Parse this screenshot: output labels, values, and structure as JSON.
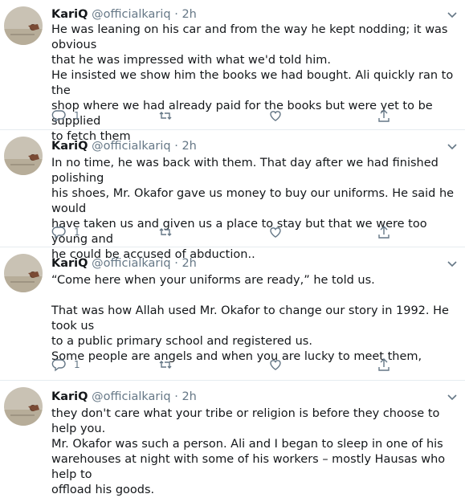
{
  "tweets": [
    {
      "name": "KariQ",
      "handle": "@officialkariq",
      "sep": "·",
      "time": "2h",
      "lines": [
        "He was leaning on his car and from the way he kept nodding; it was obvious",
        "that he was impressed with what we'd told him.",
        "He insisted we show him the books we had bought. Ali quickly ran to the",
        "shop where we had already paid for the books but were yet to be supplied",
        "to fetch them"
      ],
      "reply_count": "1"
    },
    {
      "name": "KariQ",
      "handle": "@officialkariq",
      "sep": "·",
      "time": "2h",
      "lines": [
        "In no time, he was back with them. That day after we had finished polishing",
        "his shoes, Mr. Okafor gave us money to buy our uniforms. He said he would",
        "have taken us and given us a place to stay but that we were too young and",
        "he could be accused of abduction.."
      ],
      "reply_count": "1"
    },
    {
      "name": "KariQ",
      "handle": "@officialkariq",
      "sep": "·",
      "time": "2h",
      "lines": [
        "“Come here when your uniforms are ready,” he told us.",
        "",
        "That was how Allah used Mr. Okafor to change our story in 1992. He took us",
        "to a public primary school and registered us.",
        "Some people are angels and when you are lucky to meet them,"
      ],
      "reply_count": "1"
    },
    {
      "name": "KariQ",
      "handle": "@officialkariq",
      "sep": "·",
      "time": "2h",
      "lines": [
        "they don't care what your tribe or religion is before they choose to help you.",
        "Mr. Okafor was such a person. Ali and I began to sleep in one of his",
        "warehouses at night with some of his workers – mostly Hausas who help to",
        "offload his goods."
      ],
      "reply_count": ""
    }
  ],
  "icons": {
    "reply": "reply-icon",
    "retweet": "retweet-icon",
    "like": "heart-icon",
    "share": "share-icon",
    "more": "chevron-down-icon"
  },
  "colors": {
    "text": "#14171a",
    "muted": "#657786",
    "divider": "#e6ecf0"
  }
}
